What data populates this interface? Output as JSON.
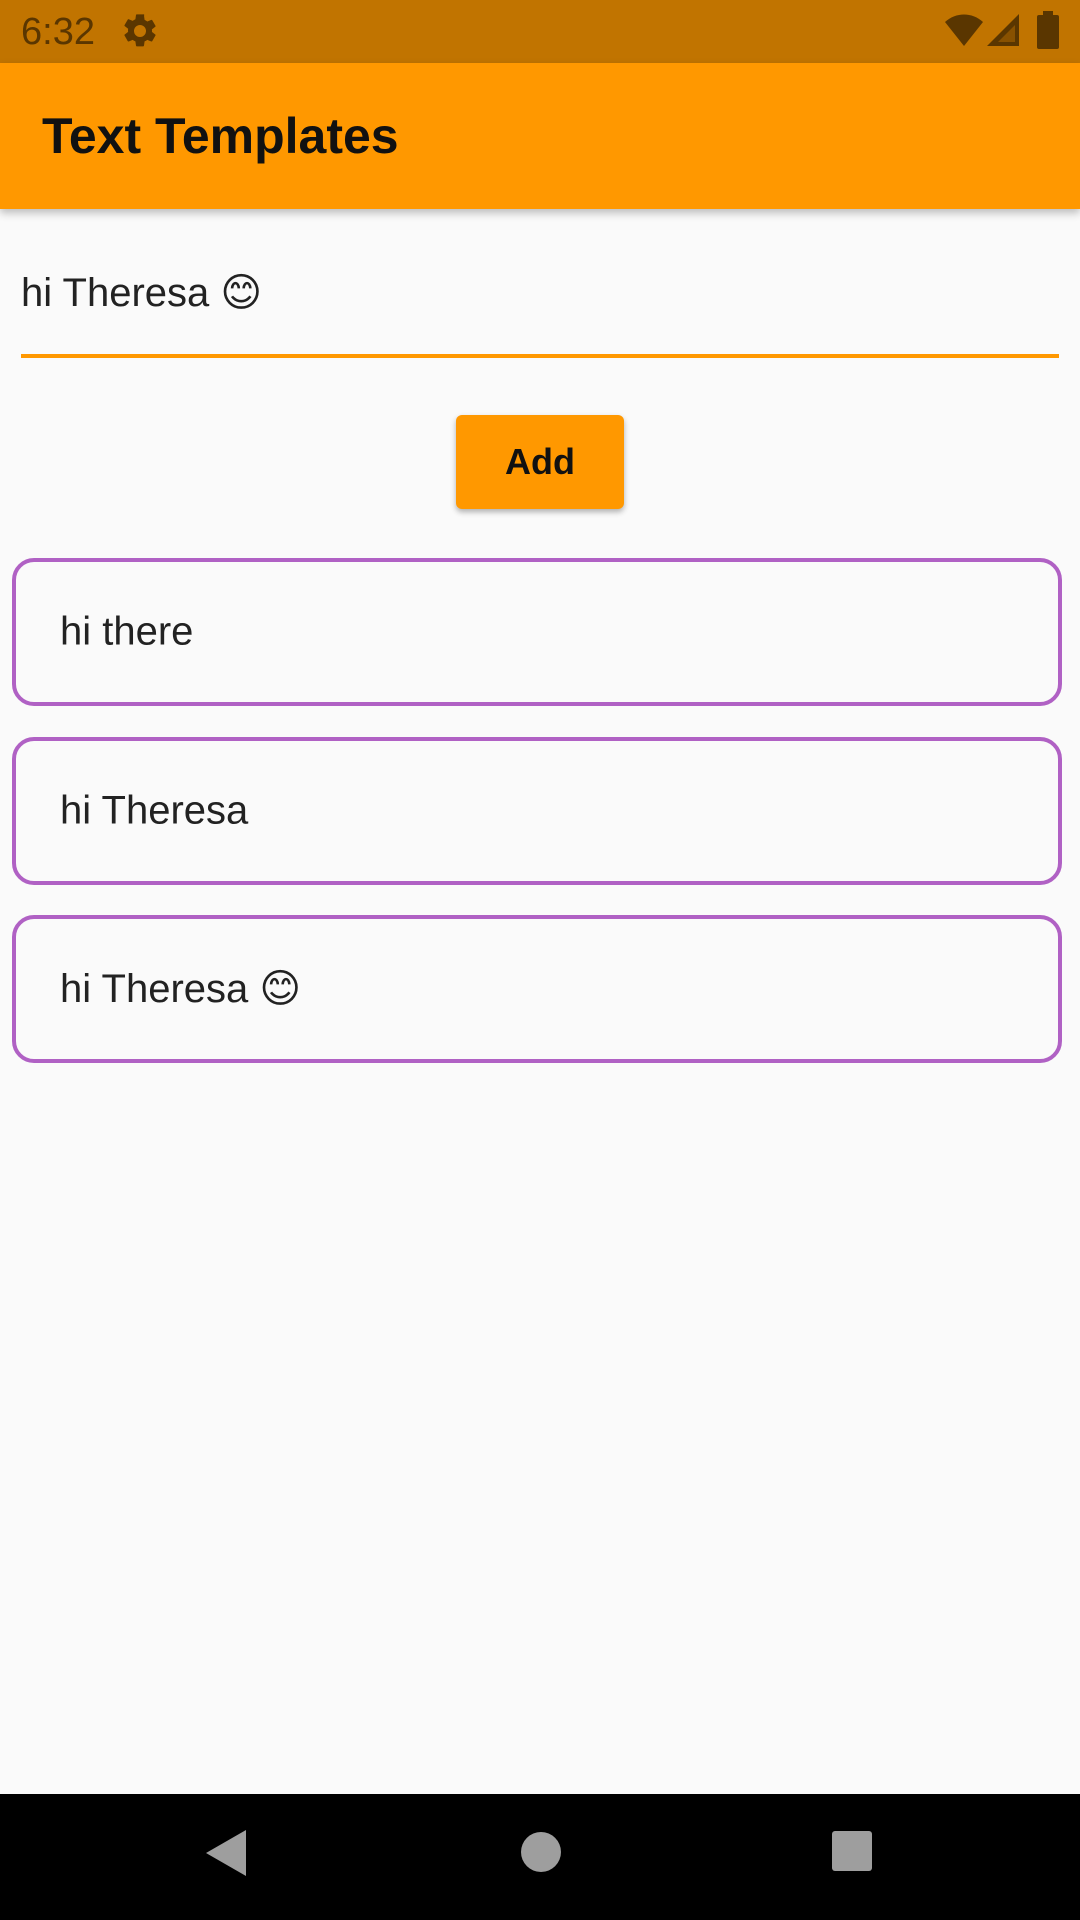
{
  "status_bar": {
    "time": "6:32",
    "icons": [
      "gear-icon",
      "wifi-icon",
      "cell-signal-icon",
      "battery-icon"
    ],
    "background_color": "#c17400"
  },
  "app_bar": {
    "title": "Text Templates",
    "background_color": "#ff9800"
  },
  "input": {
    "value": "hi Theresa 😊",
    "underline_color": "#ff9800"
  },
  "add_button": {
    "label": "Add",
    "background_color": "#ff9800"
  },
  "templates": [
    {
      "text": "hi there"
    },
    {
      "text": "hi Theresa"
    },
    {
      "text": "hi Theresa 😊"
    }
  ],
  "template_border_color": "#b061c4",
  "nav_bar": {
    "icons": [
      "back-icon",
      "home-icon",
      "recents-icon"
    ]
  }
}
